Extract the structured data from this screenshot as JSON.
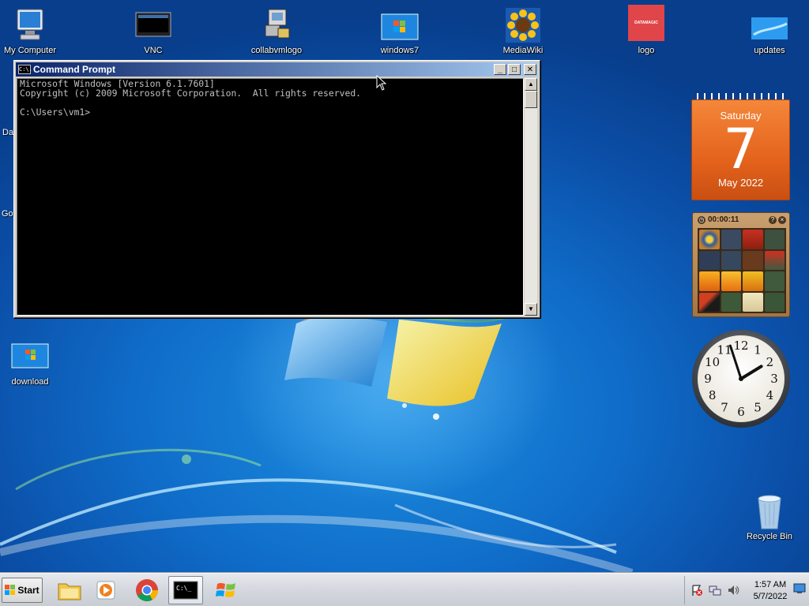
{
  "desktop_icons": [
    {
      "id": "my-computer",
      "label": "My Computer"
    },
    {
      "id": "vnc",
      "label": "VNC"
    },
    {
      "id": "collabvmlogo",
      "label": "collabvmlogo"
    },
    {
      "id": "windows7",
      "label": "windows7"
    },
    {
      "id": "mediawiki",
      "label": "MediaWiki"
    },
    {
      "id": "logo",
      "label": "logo",
      "logo_text": "DATAMAGIC"
    },
    {
      "id": "updates",
      "label": "updates"
    },
    {
      "id": "download",
      "label": "download"
    },
    {
      "id": "recycle-bin",
      "label": "Recycle Bin"
    }
  ],
  "partial_icon_labels": [
    "Da",
    "Goo"
  ],
  "cmd_window": {
    "title": "Command Prompt",
    "icon_text": "C:\\.",
    "buttons": {
      "minimize": "_",
      "maximize": "□",
      "close": "✕"
    },
    "lines": [
      "Microsoft Windows [Version 6.1.7601]",
      "Copyright (c) 2009 Microsoft Corporation.  All rights reserved.",
      "",
      "C:\\Users\\vm1>"
    ]
  },
  "calendar_gadget": {
    "weekday": "Saturday",
    "day": "7",
    "month_year": "May 2022"
  },
  "puzzle_gadget": {
    "timer": "00:00:11",
    "help_btn": "?",
    "close_btn": "×"
  },
  "clock_gadget": {
    "numbers": [
      "12",
      "1",
      "2",
      "3",
      "4",
      "5",
      "6",
      "7",
      "8",
      "9",
      "10",
      "11"
    ],
    "hour": 1,
    "minute": 57
  },
  "taskbar": {
    "start_label": "Start",
    "pinned": [
      "file-explorer",
      "media-player",
      "chrome",
      "command-prompt",
      "windows-update"
    ],
    "clock_time": "1:57 AM",
    "clock_date": "5/7/2022"
  },
  "colors": {
    "accent_titlebar": "#0a246a",
    "calendar_orange": "#e4631c",
    "desktop_blue": "#0f6cc8"
  }
}
